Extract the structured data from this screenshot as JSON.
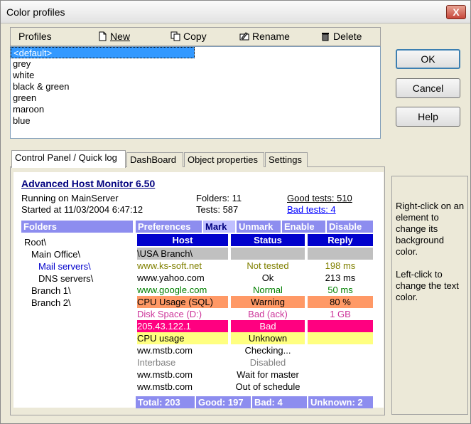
{
  "window": {
    "title": "Color profiles",
    "close_glyph": "X"
  },
  "toolbar": {
    "profiles_label": "Profiles",
    "new_label": "New",
    "copy_label": "Copy",
    "rename_label": "Rename",
    "delete_label": "Delete"
  },
  "profiles": [
    "<default>",
    "grey",
    "white",
    "black & green",
    "green",
    "maroon",
    "blue"
  ],
  "buttons": {
    "ok": "OK",
    "cancel": "Cancel",
    "help": "Help"
  },
  "tabs": [
    "Control Panel / Quick log",
    "DashBoard",
    "Object properties",
    "Settings"
  ],
  "hint": {
    "line1": "Right-click on an element to change its background color.",
    "line2": "Left-click to change the text color."
  },
  "preview": {
    "app_title": "Advanced Host Monitor 6.50",
    "running": "Running on MainServer",
    "started": "Started at 11/03/2004 6:47:12",
    "folders_count": "Folders: 11",
    "tests_count": "Tests: 587",
    "good_tests": "Good tests: 510",
    "bad_tests": "Bad tests: 4",
    "folders_header": "Folders",
    "tree": [
      "Root\\",
      "Main Office\\",
      "Mail servers\\",
      "DNS servers\\",
      "Branch 1\\",
      "Branch 2\\"
    ],
    "actions": [
      "Preferences",
      "Mark",
      "Unmark",
      "Enable",
      "Disable"
    ],
    "columns": [
      "Host",
      "Status",
      "Reply"
    ],
    "rows": [
      [
        "\\USA Branch\\",
        "",
        ""
      ],
      [
        "www.ks-soft.net",
        "Not tested",
        "198 ms"
      ],
      [
        "www.yahoo.com",
        "Ok",
        "213 ms"
      ],
      [
        "www.google.com",
        "Normal",
        "50 ms"
      ],
      [
        "CPU Usage (SQL)",
        "Warning",
        "80 %"
      ],
      [
        "Disk Space (D:)",
        "Bad (ack)",
        "1 GB"
      ],
      [
        "205.43.122.1",
        "Bad",
        ""
      ],
      [
        "CPU usage",
        "Unknown",
        ""
      ],
      [
        "ww.mstb.com",
        "Checking...",
        ""
      ],
      [
        "Interbase",
        "Disabled",
        ""
      ],
      [
        "ww.mstb.com",
        "Wait for master",
        ""
      ],
      [
        "ww.mstb.com",
        "Out of schedule",
        ""
      ]
    ],
    "row_styles": [
      {
        "bg": "#c0c0c0",
        "fg": "#000000"
      },
      {
        "bg": "#ffffff",
        "fg": "#808000"
      },
      {
        "bg": "#ffffff",
        "fg": "#000000"
      },
      {
        "bg": "#ffffff",
        "fg": "#008000"
      },
      {
        "bg": "#ff9966",
        "fg": "#000000"
      },
      {
        "bg": "#ffffff",
        "fg": "#cc3399"
      },
      {
        "bg": "#ff0080",
        "fg": "#ffffff"
      },
      {
        "bg": "#ffff80",
        "fg": "#000000"
      },
      {
        "bg": "#ffffff",
        "fg": "#000000"
      },
      {
        "bg": "#ffffff",
        "fg": "#808080"
      },
      {
        "bg": "#ffffff",
        "fg": "#000000"
      },
      {
        "bg": "#ffffff",
        "fg": "#000000"
      }
    ],
    "footer": [
      "Total: 203",
      "Good: 197",
      "Bad: 4",
      "Unknown: 2"
    ]
  }
}
